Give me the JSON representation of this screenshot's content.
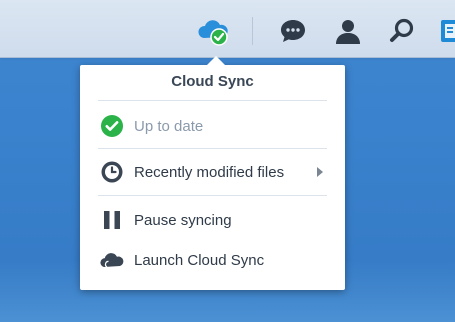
{
  "taskbar": {
    "icons": [
      {
        "name": "cloud-sync-status-icon"
      },
      {
        "name": "chat-icon"
      },
      {
        "name": "user-icon"
      },
      {
        "name": "search-icon"
      },
      {
        "name": "widgets-icon"
      }
    ]
  },
  "popup": {
    "title": "Cloud Sync",
    "status_label": "Up to date",
    "items": [
      {
        "label": "Recently modified files",
        "has_submenu": true
      },
      {
        "label": "Pause syncing"
      },
      {
        "label": "Launch Cloud Sync"
      }
    ]
  },
  "colors": {
    "desktop_blue": "#3a82cd",
    "taskbar_bg": "#d6e1ee",
    "icon_dark": "#2f3b48",
    "status_green": "#2bb34a",
    "cloud_blue": "#2a8fdb"
  }
}
